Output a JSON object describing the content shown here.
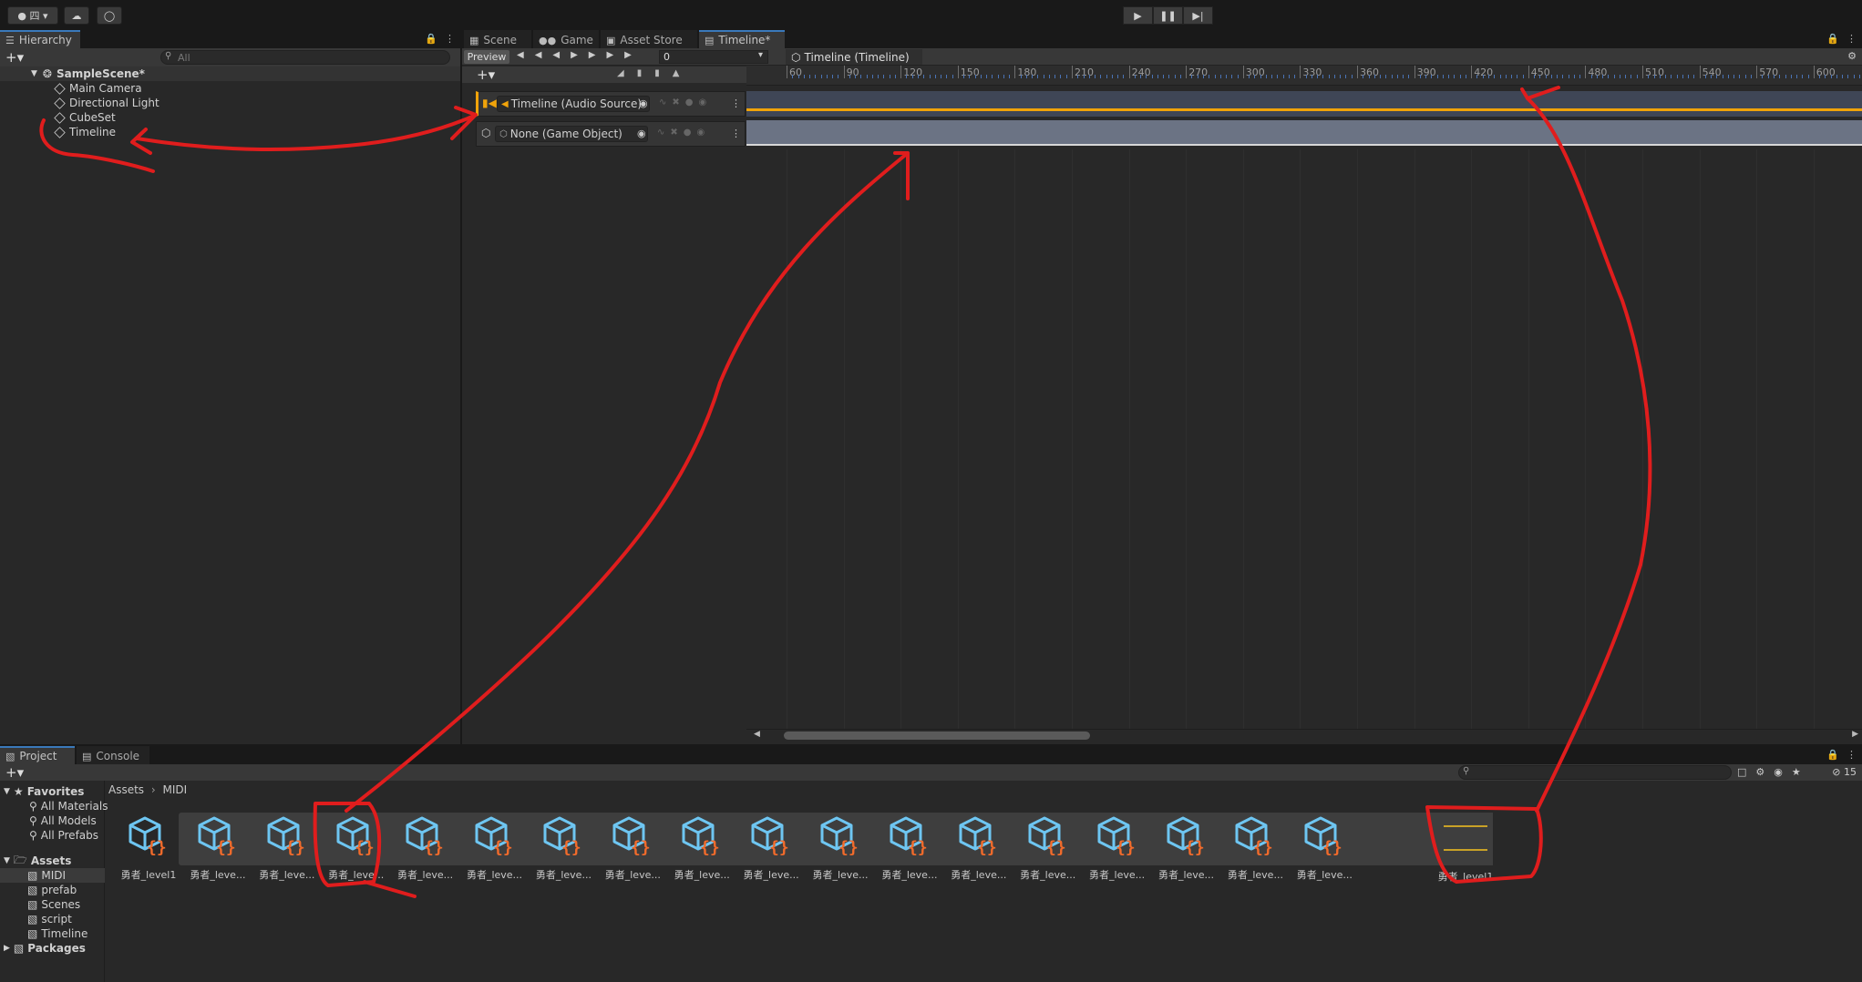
{
  "toolbar": {
    "account_label": "四",
    "cloud_icon": "cloud-icon",
    "collab_icon": "collab-icon",
    "play_icon": "play-icon",
    "pause_icon": "pause-icon",
    "step_icon": "step-icon"
  },
  "hierarchy": {
    "tab": "Hierarchy",
    "search_placeholder": "All",
    "scene": "SampleScene*",
    "items": [
      "Main Camera",
      "Directional Light",
      "CubeSet",
      "Timeline"
    ]
  },
  "scene_tabs": {
    "tabs": [
      "Scene",
      "Game",
      "Asset Store",
      "Timeline*"
    ]
  },
  "timeline": {
    "preview_label": "Preview",
    "frame_value": "0",
    "asset_title": "Timeline (Timeline)",
    "ruler_ticks": [
      "60",
      "90",
      "120",
      "150",
      "180",
      "210",
      "240",
      "270",
      "300",
      "330",
      "360",
      "390",
      "420",
      "450",
      "480",
      "510",
      "540",
      "570",
      "600"
    ],
    "tracks": [
      {
        "label": "Timeline (Audio Source)"
      },
      {
        "label": "None (Game Object)"
      }
    ]
  },
  "project": {
    "tabs": [
      "Project",
      "Console"
    ],
    "favorites_label": "Favorites",
    "favorites": [
      "All Materials",
      "All Models",
      "All Prefabs"
    ],
    "assets_label": "Assets",
    "asset_folders": [
      "MIDI",
      "prefab",
      "Scenes",
      "script",
      "Timeline"
    ],
    "packages_label": "Packages",
    "breadcrumb": [
      "Assets",
      "MIDI"
    ],
    "hidden_count": "15",
    "midi_assets": [
      "勇者_level1",
      "勇者_leve...",
      "勇者_leve...",
      "勇者_leve...",
      "勇者_leve...",
      "勇者_leve...",
      "勇者_leve...",
      "勇者_leve...",
      "勇者_leve...",
      "勇者_leve...",
      "勇者_leve...",
      "勇者_leve...",
      "勇者_leve...",
      "勇者_leve...",
      "勇者_leve...",
      "勇者_leve...",
      "勇者_leve...",
      "勇者_leve..."
    ],
    "timeline_asset": "勇者_level1"
  },
  "colors": {
    "annotation": "#e01d1d",
    "accent": "#f0a30a",
    "asset_cube": "#6ec6f2",
    "asset_braces": "#f26b2b"
  }
}
